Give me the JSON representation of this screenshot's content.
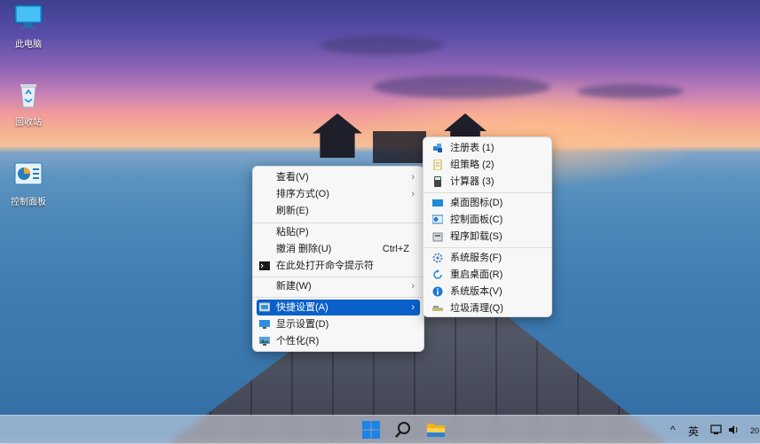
{
  "desktop": {
    "icons": [
      {
        "label": "此电脑",
        "icon": "monitor-icon"
      },
      {
        "label": "回收站",
        "icon": "recycle-bin-icon"
      },
      {
        "label": "控制面板",
        "icon": "control-panel-icon"
      }
    ]
  },
  "context_menu": {
    "items": [
      {
        "label": "查看(V)",
        "submenu": true
      },
      {
        "label": "排序方式(O)",
        "submenu": true
      },
      {
        "label": "刷新(E)"
      },
      {
        "label": "粘贴(P)"
      },
      {
        "label": "撤消 删除(U)",
        "shortcut": "Ctrl+Z"
      },
      {
        "label": "在此处打开命令提示符",
        "icon": "cmd-icon"
      },
      {
        "label": "新建(W)",
        "submenu": true
      },
      {
        "label": "快捷设置(A)",
        "submenu": true,
        "icon": "quick-settings-icon",
        "highlighted": true
      },
      {
        "label": "显示设置(D)",
        "icon": "display-icon"
      },
      {
        "label": "个性化(R)",
        "icon": "personalize-icon"
      }
    ]
  },
  "submenu": {
    "items": [
      {
        "label": "注册表  (1)",
        "icon": "registry-icon"
      },
      {
        "label": "组策略  (2)",
        "icon": "policy-icon"
      },
      {
        "label": "计算器  (3)",
        "icon": "calculator-icon"
      },
      {
        "label": "桌面图标(D)",
        "icon": "desktop-icon"
      },
      {
        "label": "控制面板(C)",
        "icon": "control-panel-icon"
      },
      {
        "label": "程序卸载(S)",
        "icon": "uninstall-icon"
      },
      {
        "label": "系统服务(F)",
        "icon": "services-icon"
      },
      {
        "label": "重启桌面(R)",
        "icon": "restart-icon"
      },
      {
        "label": "系统版本(V)",
        "icon": "info-icon"
      },
      {
        "label": "垃圾清理(Q)",
        "icon": "cleanup-icon"
      }
    ]
  },
  "taskbar": {
    "apps": [
      "start-icon",
      "search-icon",
      "file-explorer-icon"
    ],
    "tray": {
      "chevron": "^",
      "ime": "英",
      "clock_partial": "20"
    }
  },
  "colors": {
    "highlight": "#0a60c9",
    "menu_bg": "#f7f7f7"
  }
}
